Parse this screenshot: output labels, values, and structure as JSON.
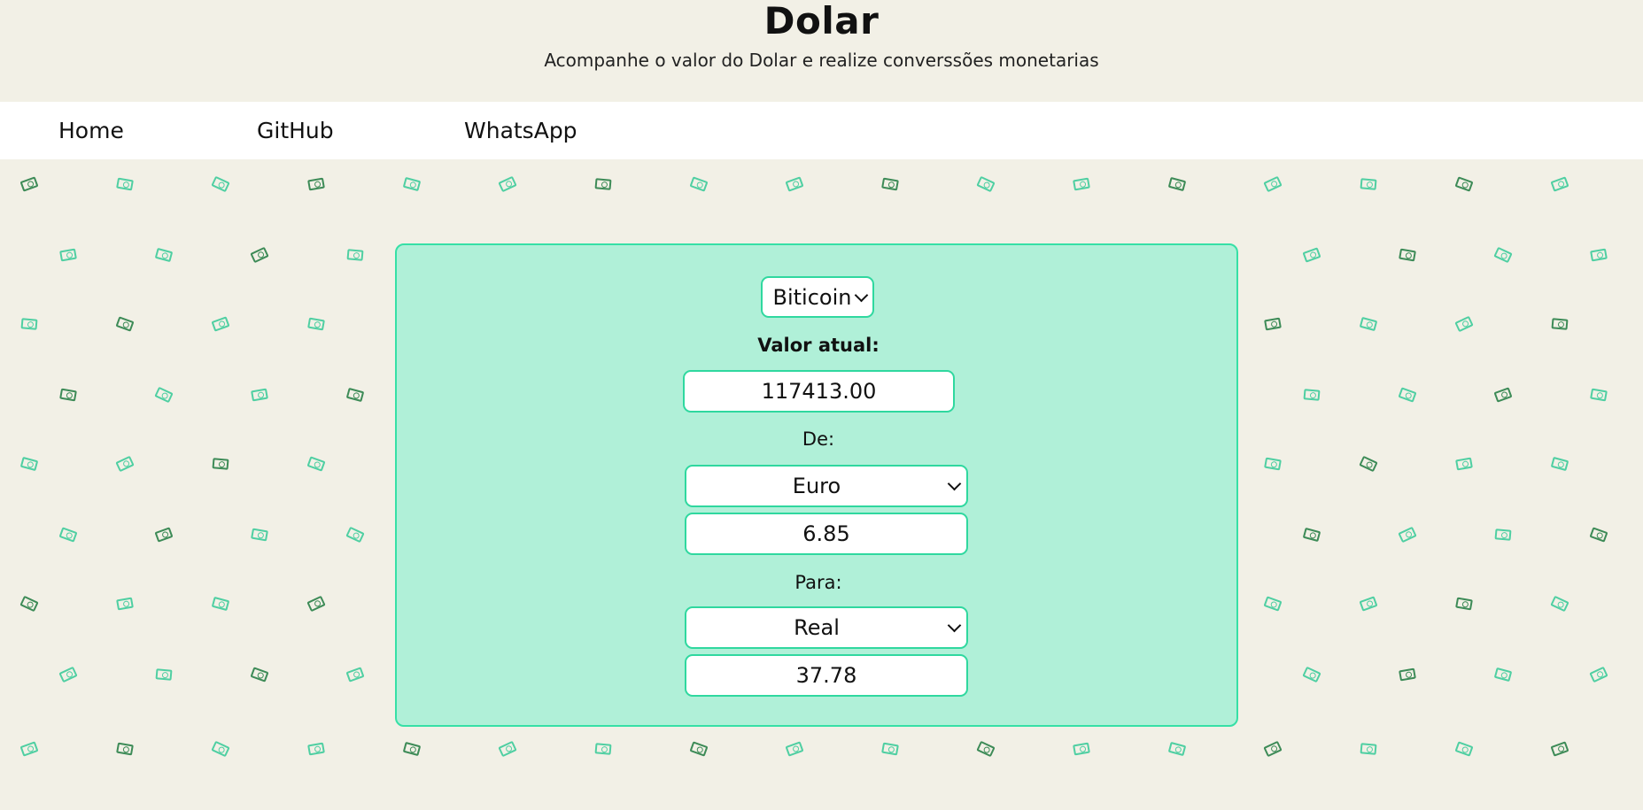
{
  "header": {
    "title": "Dolar",
    "subtitle": "Acompanhe o valor do Dolar e realize converssões monetarias"
  },
  "nav": {
    "home": "Home",
    "github": "GitHub",
    "whatsapp": "WhatsApp"
  },
  "converter": {
    "currency_select": "Biticoin",
    "current_value_label": "Valor atual:",
    "current_value": "117413.00",
    "from_label": "De:",
    "from_currency": "Euro",
    "from_amount": "6.85",
    "to_label": "Para:",
    "to_currency": "Real",
    "to_amount": "37.78"
  },
  "colors": {
    "background": "#f2f0e6",
    "panel": "#b0f0d8",
    "panel_border": "#36e0a6",
    "input_border": "#2fd89f",
    "money_icon_teal": "#4fcfa2",
    "money_icon_green": "#3d8b57"
  },
  "icons": {
    "money": "money-bill-icon",
    "chevron": "chevron-down-icon"
  }
}
